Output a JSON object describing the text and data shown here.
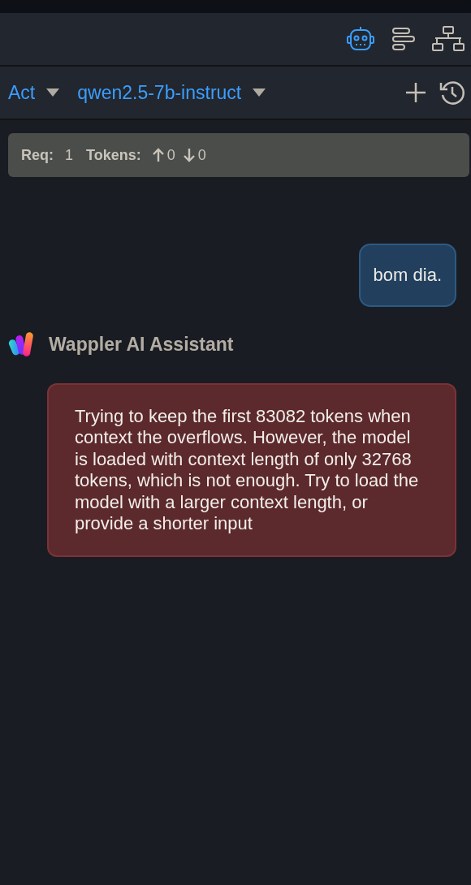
{
  "view_tabs": [
    {
      "kind": "robot",
      "selected": true
    },
    {
      "kind": "outline",
      "selected": false
    },
    {
      "kind": "sitemap",
      "selected": false
    }
  ],
  "toolbar": {
    "mode": "Act",
    "model": "qwen2.5-7b-instruct"
  },
  "stats": {
    "req_label": "Req:",
    "req_value": "1",
    "tokens_label": "Tokens:",
    "tokens_up": "0",
    "tokens_down": "0"
  },
  "messages": [
    {
      "kind": "user",
      "text": "bom dia."
    },
    {
      "kind": "assistant",
      "sender": "Wappler AI Assistant",
      "error": true,
      "text": "Trying to keep the first 83082 tokens when context the overflows. However, the model is loaded with context length of only 32768 tokens, which is not enough. Try to load the model with a larger context length, or provide a shorter input"
    }
  ]
}
